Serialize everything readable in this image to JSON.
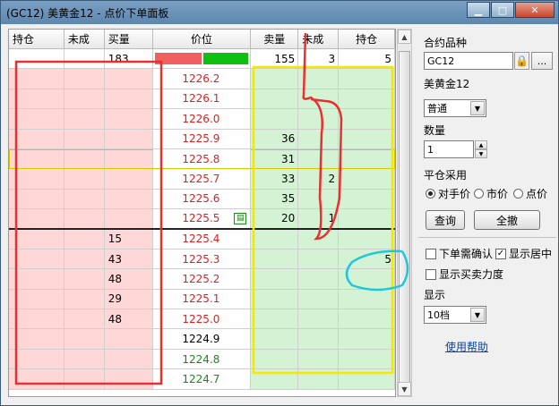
{
  "window": {
    "title": "(GC12) 美黄金12 - 点价下单面板",
    "controls": {
      "minimize": "▁",
      "maximize": "□",
      "close": "✕"
    }
  },
  "table": {
    "headers": [
      "持仓",
      "未成",
      "买量",
      "价位",
      "卖量",
      "未成",
      "持仓"
    ],
    "top_row": {
      "buy_vol": "183",
      "sell_vol": "155",
      "sell_pending": "3",
      "sell_pos": "5"
    },
    "rows": [
      {
        "price": "1226.2",
        "buy_vol": "",
        "sell_vol": "",
        "sell_pending": "",
        "sell_pos": "",
        "price_color": "red",
        "side": "ask"
      },
      {
        "price": "1226.1",
        "buy_vol": "",
        "sell_vol": "",
        "sell_pending": "",
        "sell_pos": "",
        "price_color": "red",
        "side": "ask"
      },
      {
        "price": "1226.0",
        "buy_vol": "",
        "sell_vol": "",
        "sell_pending": "",
        "sell_pos": "",
        "price_color": "red",
        "side": "ask"
      },
      {
        "price": "1225.9",
        "buy_vol": "",
        "sell_vol": "36",
        "sell_pending": "",
        "sell_pos": "",
        "price_color": "red",
        "side": "ask"
      },
      {
        "price": "1225.8",
        "buy_vol": "",
        "sell_vol": "31",
        "sell_pending": "",
        "sell_pos": "",
        "price_color": "red",
        "side": "ask",
        "highlight": true
      },
      {
        "price": "1225.7",
        "buy_vol": "",
        "sell_vol": "33",
        "sell_pending": "2",
        "sell_pos": "",
        "price_color": "red",
        "side": "ask"
      },
      {
        "price": "1225.6",
        "buy_vol": "",
        "sell_vol": "35",
        "sell_pending": "",
        "sell_pos": "",
        "price_color": "red",
        "side": "ask"
      },
      {
        "price": "1225.5",
        "buy_vol": "",
        "sell_vol": "20",
        "sell_pending": "1",
        "sell_pos": "",
        "price_color": "red",
        "side": "ask",
        "order_icon": true,
        "divider": true
      },
      {
        "price": "1225.4",
        "buy_vol": "15",
        "sell_vol": "",
        "sell_pending": "",
        "sell_pos": "",
        "price_color": "red",
        "side": "bid",
        "mark_icon": true
      },
      {
        "price": "1225.3",
        "buy_vol": "43",
        "sell_vol": "",
        "sell_pending": "",
        "sell_pos": "5",
        "price_color": "red",
        "side": "bid"
      },
      {
        "price": "1225.2",
        "buy_vol": "48",
        "sell_vol": "",
        "sell_pending": "",
        "sell_pos": "",
        "price_color": "red",
        "side": "bid"
      },
      {
        "price": "1225.1",
        "buy_vol": "29",
        "sell_vol": "",
        "sell_pending": "",
        "sell_pos": "",
        "price_color": "red",
        "side": "bid"
      },
      {
        "price": "1225.0",
        "buy_vol": "48",
        "sell_vol": "",
        "sell_pending": "",
        "sell_pos": "",
        "price_color": "red",
        "side": "bid"
      },
      {
        "price": "1224.9",
        "buy_vol": "",
        "sell_vol": "",
        "sell_pending": "",
        "sell_pos": "",
        "price_color": "black",
        "side": "bid"
      },
      {
        "price": "1224.8",
        "buy_vol": "",
        "sell_vol": "",
        "sell_pending": "",
        "sell_pos": "",
        "price_color": "green",
        "side": "bid"
      },
      {
        "price": "1224.7",
        "buy_vol": "",
        "sell_vol": "",
        "sell_pending": "",
        "sell_pos": "",
        "price_color": "green",
        "side": "bid"
      }
    ]
  },
  "panel": {
    "contract_label": "合约品种",
    "contract_code": "GC12",
    "lock_icon": "lock-icon",
    "more_button": "...",
    "contract_name": "美黄金12",
    "order_type": "普通",
    "qty_label": "数量",
    "qty_value": "1",
    "close_label": "平仓采用",
    "close_options": [
      "对手价",
      "市价",
      "点价"
    ],
    "close_selected": 0,
    "query_button": "查询",
    "cancel_all_button": "全撤",
    "confirm_label": "下单需确认",
    "center_label": "显示居中",
    "strength_label": "显示买卖力度",
    "display_label": "显示",
    "depth_value": "10档",
    "help_link": "使用帮助"
  },
  "colors": {
    "bid_bg": "#ffd7d7",
    "ask_bg": "#d4f2d4",
    "price_red": "#e02020",
    "price_green": "#168a16"
  }
}
